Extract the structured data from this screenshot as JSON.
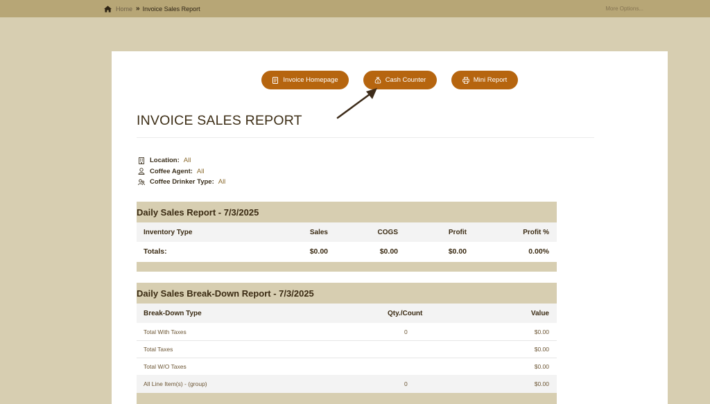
{
  "breadcrumb": {
    "home": "Home",
    "separator": "»",
    "current": "Invoice Sales Report"
  },
  "topbar": {
    "more_options": "More Options..."
  },
  "buttons": {
    "invoice_homepage": "Invoice Homepage",
    "cash_counter": "Cash Counter",
    "mini_report": "Mini Report"
  },
  "page": {
    "title": "INVOICE SALES REPORT"
  },
  "filters": {
    "location": {
      "label": "Location:",
      "value": "All"
    },
    "coffee_agent": {
      "label": "Coffee Agent:",
      "value": "All"
    },
    "coffee_drinker_type": {
      "label": "Coffee Drinker Type:",
      "value": "All"
    }
  },
  "daily_sales": {
    "title": "Daily Sales Report - 7/3/2025",
    "headers": {
      "inventory_type": "Inventory Type",
      "sales": "Sales",
      "cogs": "COGS",
      "profit": "Profit",
      "profit_pct": "Profit %"
    },
    "totals": {
      "label": "Totals:",
      "sales": "$0.00",
      "cogs": "$0.00",
      "profit": "$0.00",
      "profit_pct": "0.00%"
    }
  },
  "breakdown": {
    "title": "Daily Sales Break-Down Report - 7/3/2025",
    "headers": {
      "type": "Break-Down Type",
      "qty": "Qty./Count",
      "value": "Value"
    },
    "rows": [
      {
        "type": "Total With Taxes",
        "qty": "0",
        "value": "$0.00"
      },
      {
        "type": "Total Taxes",
        "qty": "",
        "value": "$0.00"
      },
      {
        "type": "Total W/O Taxes",
        "qty": "",
        "value": "$0.00"
      },
      {
        "type": "All Line Item(s) - (group)",
        "qty": "0",
        "value": "$0.00"
      }
    ]
  },
  "colors": {
    "accent": "#b6650f",
    "page_bg": "#d7ceb1",
    "topbar": "#b7a676",
    "section_bg": "#d7ceb1"
  },
  "icons": {
    "home": "home-icon",
    "invoice": "document-icon",
    "cash": "money-bag-icon",
    "mini": "printer-icon",
    "location": "building-icon",
    "agent": "user-icon",
    "drinker": "users-icon"
  }
}
